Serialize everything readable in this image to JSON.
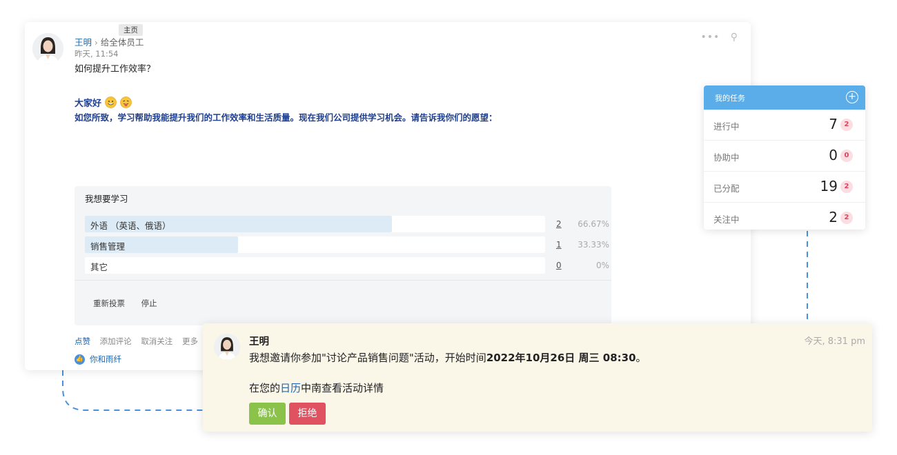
{
  "post": {
    "author": "王明",
    "recipient": "给全体员工",
    "tooltip": "主页",
    "time": "昨天, 11:54",
    "subject": "如何提升工作效率？",
    "greeting": "大家好",
    "message": "如您所致，学习帮助我能提升我们的工作效率和生活质量。现在我们公司提供学习机会。请告诉我你们的愿望：",
    "icons": [
      "more-icon",
      "pin-icon"
    ],
    "poll": {
      "title": "我想要学习",
      "options": [
        {
          "label": "外语 （英语、俄语）",
          "count": "2",
          "percent": "66.67%",
          "fill": 0.6667
        },
        {
          "label": "销售管理",
          "count": "1",
          "percent": "33.33%",
          "fill": 0.3333
        },
        {
          "label": "其它",
          "count": "0",
          "percent": "0%",
          "fill": 0
        }
      ],
      "revote": "重新投票",
      "stop": "停止"
    },
    "actions": {
      "like": "点赞",
      "comment": "添加评论",
      "unfollow": "取消关注",
      "more": "更多"
    },
    "likers": "你和雨纤"
  },
  "tasks": {
    "title": "我的任务",
    "rows": [
      {
        "label": "进行中",
        "count": "7",
        "badge": "2"
      },
      {
        "label": "协助中",
        "count": "0",
        "badge": "0"
      },
      {
        "label": "已分配",
        "count": "19",
        "badge": "2"
      },
      {
        "label": "关注中",
        "count": "2",
        "badge": "2"
      }
    ],
    "header_color": "#5aade8"
  },
  "invite": {
    "sender": "王明",
    "time": "今天, 8:31 pm",
    "text_prefix": "我想邀请你参加\"讨论产品销售问题\"活动，开始时间",
    "text_datetime": "2022年10月26日 周三 08:30",
    "text_suffix": "。",
    "cal_prefix": "在您的",
    "cal_link": "日历",
    "cal_suffix": "中南查看活动详情",
    "confirm": "确认",
    "reject": "拒绝"
  }
}
